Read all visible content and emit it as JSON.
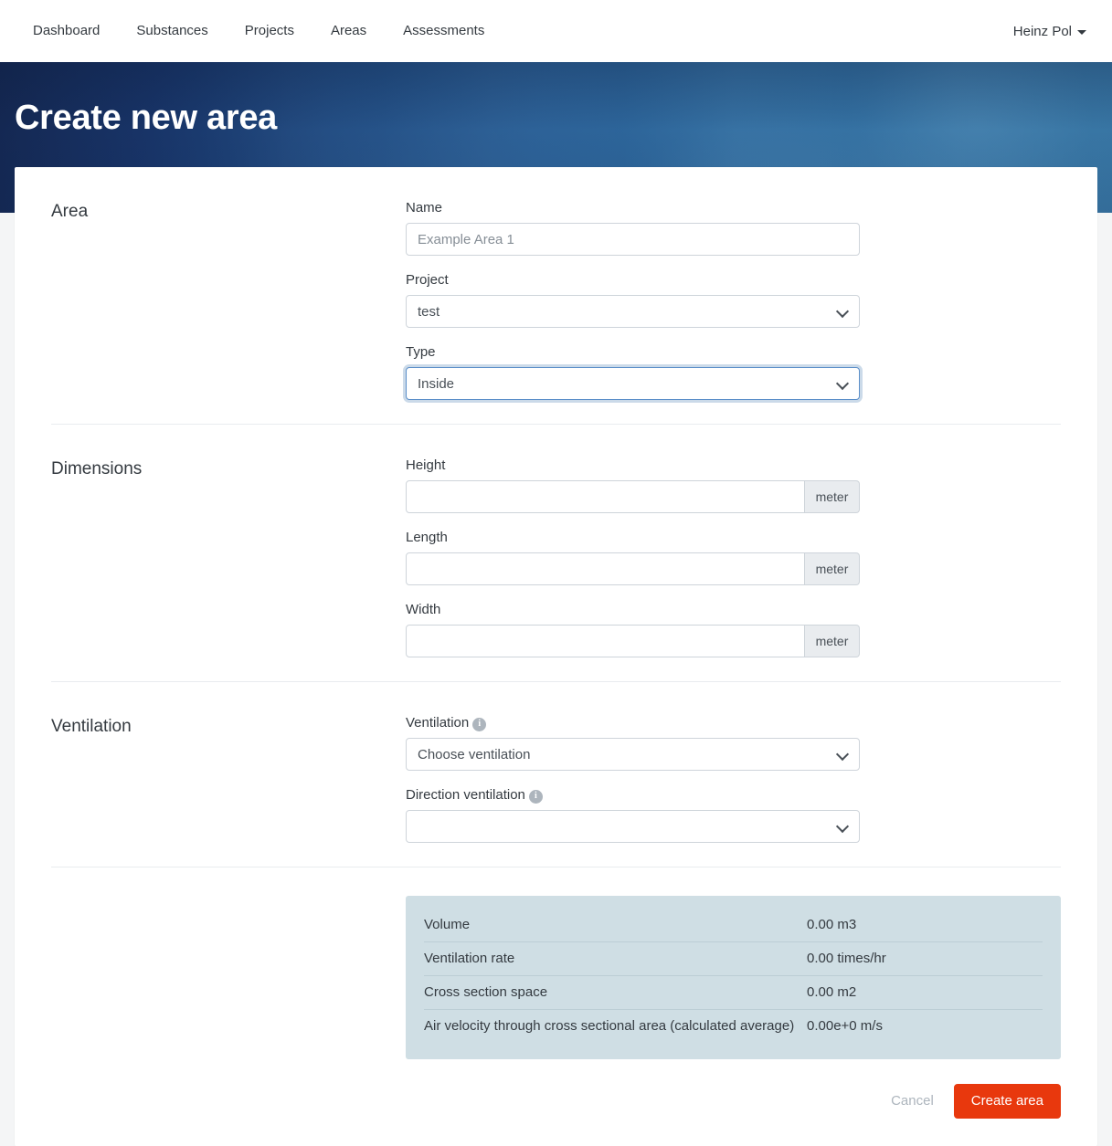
{
  "navbar": {
    "links": [
      {
        "label": "Dashboard",
        "name": "nav-link-dashboard"
      },
      {
        "label": "Substances",
        "name": "nav-link-substances"
      },
      {
        "label": "Projects",
        "name": "nav-link-projects"
      },
      {
        "label": "Areas",
        "name": "nav-link-areas"
      },
      {
        "label": "Assessments",
        "name": "nav-link-assessments"
      }
    ],
    "user": {
      "name": "Heinz Pol",
      "caret_icon": "caret-down-icon"
    }
  },
  "hero": {
    "title": "Create new area",
    "gradient_from": "#142751",
    "gradient_to": "#4fa9d8"
  },
  "form": {
    "sections": [
      {
        "title": "Area",
        "fields": {
          "name": {
            "label": "Name",
            "value": "",
            "placeholder": "Example Area 1"
          },
          "project": {
            "label": "Project",
            "selected": "test"
          },
          "type": {
            "label": "Type",
            "selected": "Inside",
            "focused": true
          }
        }
      },
      {
        "title": "Dimensions",
        "fields": {
          "height": {
            "label": "Height",
            "value": "",
            "unit": "meter"
          },
          "length": {
            "label": "Length",
            "value": "",
            "unit": "meter"
          },
          "width": {
            "label": "Width",
            "value": "",
            "unit": "meter"
          }
        }
      },
      {
        "title": "Ventilation",
        "fields": {
          "ventilation": {
            "label": "Ventilation",
            "selected": "Choose ventilation",
            "info_icon": "info-icon"
          },
          "direction": {
            "label": "Direction ventilation",
            "selected": "",
            "info_icon": "info-icon"
          }
        }
      }
    ]
  },
  "summary": {
    "background": "#cfdee4",
    "rows": [
      {
        "label": "Volume",
        "value": "0.00 m3"
      },
      {
        "label": "Ventilation rate",
        "value": "0.00 times/hr"
      },
      {
        "label": "Cross section space",
        "value": "0.00 m2"
      },
      {
        "label": "Air velocity through cross sectional area (calculated average)",
        "value": "0.00e+0 m/s"
      }
    ]
  },
  "footer": {
    "cancel_label": "Cancel",
    "submit_label": "Create area",
    "submit_color": "#e8380d"
  }
}
